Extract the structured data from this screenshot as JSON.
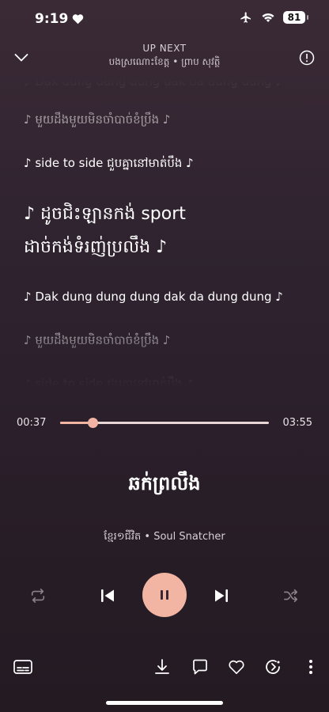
{
  "status": {
    "time": "9:19",
    "battery": "81"
  },
  "header": {
    "up_next_label": "UP NEXT",
    "up_next_song": "បងស្រណោះខែត្ត • ព្រាប សុវត្ថិ"
  },
  "lyrics": [
    "♪ Dak dung dung dung dak da dung dung ♪",
    "♪ មួយដឹងមួយមិនចាំបាច់ខំប្រឹង ♪",
    "♪ side to side ជួបគ្នានៅមាត់បឹង ♪",
    "♪ ដូចជិះឡានកង់ sport ដាច់កង់ទំរញ់ប្រលឹង ♪",
    "♪ Dak dung dung dung dak da dung dung ♪",
    "♪ មួយដឹងមួយមិនចាំបាច់ខំប្រឹង ♪",
    "♪ side to side ជួបគ្នានៅមាត់បឹង ♪"
  ],
  "player": {
    "elapsed": "00:37",
    "duration": "03:55",
    "progress_fraction": 0.157,
    "accent_color": "#f2b5a3",
    "title": "ឆក់ព្រលឹង",
    "artist_line": "ខ្មែរ១ជីវិត • Soul Snatcher"
  },
  "icons": {
    "header": [
      "chevron-down-icon",
      "info-icon"
    ],
    "controls": [
      "repeat-icon",
      "previous-icon",
      "pause-icon",
      "next-icon",
      "shuffle-icon"
    ],
    "bottom_bar": [
      "subtitles-icon",
      "download-icon",
      "comment-icon",
      "heart-icon",
      "tempo-icon",
      "more-icon"
    ]
  }
}
